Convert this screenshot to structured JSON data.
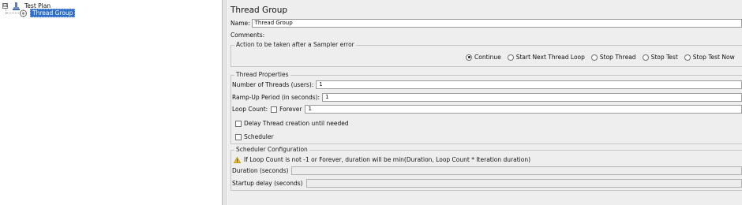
{
  "tree": {
    "items": [
      {
        "label": "Test Plan",
        "icon": "test-plan-icon",
        "expanded": true,
        "selected": false
      },
      {
        "label": "Thread Group",
        "icon": "thread-group-icon",
        "selected": true
      }
    ],
    "toggle_symbol": "⊟"
  },
  "panel": {
    "title": "Thread Group",
    "name_label": "Name:",
    "name_value": "Thread Group",
    "comments_label": "Comments:",
    "comments_value": ""
  },
  "sampler_error": {
    "legend": "Action to be taken after a Sampler error",
    "options": [
      {
        "label": "Continue",
        "checked": true
      },
      {
        "label": "Start Next Thread Loop",
        "checked": false
      },
      {
        "label": "Stop Thread",
        "checked": false
      },
      {
        "label": "Stop Test",
        "checked": false
      },
      {
        "label": "Stop Test Now",
        "checked": false
      }
    ]
  },
  "thread_properties": {
    "legend": "Thread Properties",
    "threads_label": "Number of Threads (users):",
    "threads_value": "1",
    "rampup_label": "Ramp-Up Period (in seconds):",
    "rampup_value": "1",
    "loop_label": "Loop Count:",
    "forever_label": "Forever",
    "forever_checked": false,
    "loop_value": "1",
    "delay_label": "Delay Thread creation until needed",
    "delay_checked": false,
    "scheduler_label": "Scheduler",
    "scheduler_checked": false
  },
  "scheduler_config": {
    "legend": "Scheduler Configuration",
    "warning": "If Loop Count is not -1 or Forever, duration will be min(Duration, Loop Count * Iteration duration)",
    "duration_label": "Duration (seconds)",
    "duration_value": "",
    "startup_label": "Startup delay (seconds)",
    "startup_value": ""
  }
}
